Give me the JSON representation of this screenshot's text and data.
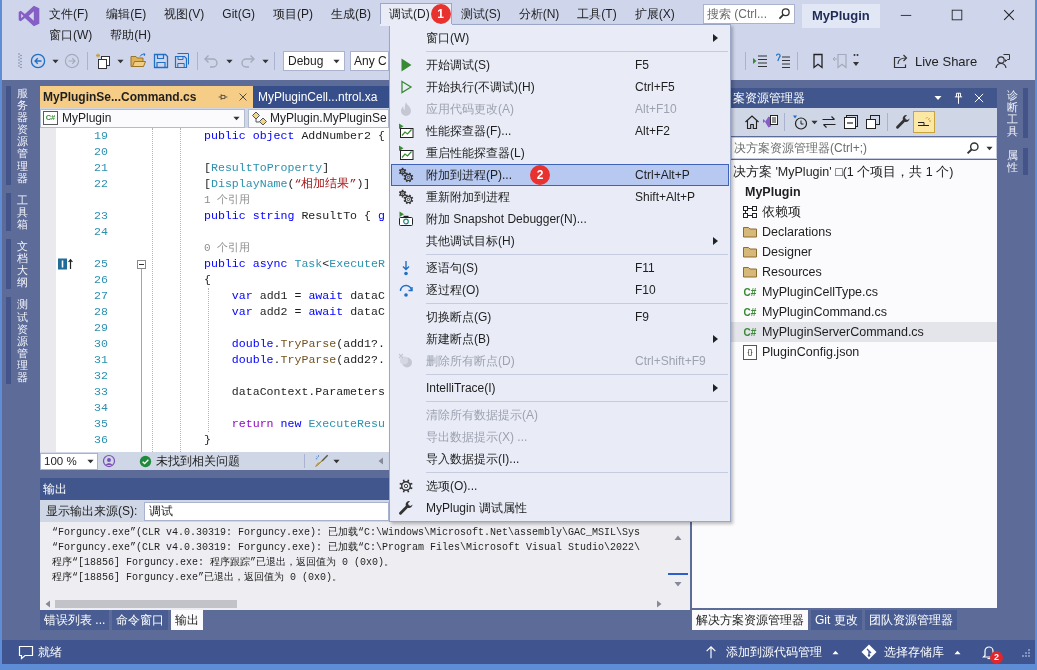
{
  "title_bar": {
    "menus": [
      {
        "label": "文件(F)",
        "selected": false
      },
      {
        "label": "编辑(E)",
        "selected": false
      },
      {
        "label": "视图(V)",
        "selected": false
      },
      {
        "label": "Git(G)",
        "selected": false
      },
      {
        "label": "项目(P)",
        "selected": false
      },
      {
        "label": "生成(B)",
        "selected": false
      },
      {
        "label": "调试(D)",
        "selected": true,
        "badge": "1"
      },
      {
        "label": "测试(S)",
        "selected": false
      },
      {
        "label": "分析(N)",
        "selected": false
      },
      {
        "label": "工具(T)",
        "selected": false
      },
      {
        "label": "扩展(X)",
        "selected": false
      },
      {
        "label": "窗口(W)",
        "selected": false
      },
      {
        "label": "帮助(H)",
        "selected": false
      }
    ],
    "search": {
      "placeholder": "搜索 (Ctrl..."
    },
    "title": "MyPlugin"
  },
  "toolbar": {
    "configuration": "Debug",
    "platform": "Any C",
    "live_share": "Live Share"
  },
  "left_tool_tabs": [
    "服务器资源管理器",
    "工具箱",
    "文档大纲",
    "测试资源管理器"
  ],
  "editor": {
    "tabs": [
      {
        "label": "MyPluginSe...Command.cs",
        "selected": true
      },
      {
        "label": "MyPluginCell...ntrol.xa",
        "selected": false
      }
    ],
    "project_selector": {
      "icon_text": "C#",
      "label": "MyPlugin"
    },
    "member_selector": "MyPlugin.MyPluginSe",
    "lines": [
      {
        "kind": "code",
        "number": "19",
        "tokens": [
          {
            "text": "public object ",
            "kind": "keyword"
          },
          {
            "text": "AddNumber2 {",
            "kind": "plain"
          }
        ]
      },
      {
        "kind": "code",
        "number": "20"
      },
      {
        "kind": "code",
        "number": "21",
        "tokens": [
          {
            "text": "[",
            "kind": "plain"
          },
          {
            "text": "ResultToProperty",
            "kind": "type"
          },
          {
            "text": "]",
            "kind": "plain"
          }
        ]
      },
      {
        "kind": "code",
        "number": "22",
        "tokens": [
          {
            "text": "[",
            "kind": "plain"
          },
          {
            "text": "DisplayName",
            "kind": "type"
          },
          {
            "text": "(",
            "kind": "plain"
          },
          {
            "text": "“相加结果”",
            "kind": "string"
          },
          {
            "text": ")]",
            "kind": "plain"
          }
        ]
      },
      {
        "kind": "codelens",
        "text": "1 个引用"
      },
      {
        "kind": "code",
        "number": "23",
        "tokens": [
          {
            "text": "public string ",
            "kind": "keyword"
          },
          {
            "text": "ResultTo { ",
            "kind": "plain"
          },
          {
            "text": "g",
            "kind": "keyword"
          }
        ]
      },
      {
        "kind": "code",
        "number": "24"
      },
      {
        "kind": "codelens",
        "text": "0 个引用"
      },
      {
        "kind": "code",
        "number": "25",
        "marker": true,
        "fold": {
          "expanded": true
        },
        "tokens": [
          {
            "text": "public async ",
            "kind": "keyword"
          },
          {
            "text": "Task",
            "kind": "type"
          },
          {
            "text": "<",
            "kind": "plain"
          },
          {
            "text": "ExecuteR",
            "kind": "type"
          }
        ]
      },
      {
        "kind": "code",
        "number": "26",
        "tokens": [
          {
            "text": "{",
            "kind": "plain"
          }
        ]
      },
      {
        "kind": "code",
        "number": "27",
        "tokens": [
          {
            "text": "    var ",
            "kind": "keyword"
          },
          {
            "text": "add1 = ",
            "kind": "plain"
          },
          {
            "text": "await ",
            "kind": "keyword"
          },
          {
            "text": "dataC",
            "kind": "plain"
          }
        ]
      },
      {
        "kind": "code",
        "number": "28",
        "tokens": [
          {
            "text": "    var ",
            "kind": "keyword"
          },
          {
            "text": "add2 = ",
            "kind": "plain"
          },
          {
            "text": "await ",
            "kind": "keyword"
          },
          {
            "text": "dataC",
            "kind": "plain"
          }
        ]
      },
      {
        "kind": "code",
        "number": "29"
      },
      {
        "kind": "code",
        "number": "30",
        "tokens": [
          {
            "text": "    double",
            "kind": "keyword"
          },
          {
            "text": ".",
            "kind": "plain"
          },
          {
            "text": "TryParse",
            "kind": "method"
          },
          {
            "text": "(add1?.",
            "kind": "plain"
          }
        ]
      },
      {
        "kind": "code",
        "number": "31",
        "tokens": [
          {
            "text": "    double",
            "kind": "keyword"
          },
          {
            "text": ".",
            "kind": "plain"
          },
          {
            "text": "TryParse",
            "kind": "method"
          },
          {
            "text": "(add2?.",
            "kind": "plain"
          }
        ]
      },
      {
        "kind": "code",
        "number": "32"
      },
      {
        "kind": "code",
        "number": "33",
        "tokens": [
          {
            "text": "    dataContext.Parameters",
            "kind": "plain"
          }
        ]
      },
      {
        "kind": "code",
        "number": "34"
      },
      {
        "kind": "code",
        "number": "35",
        "tokens": [
          {
            "text": "    return ",
            "kind": "control"
          },
          {
            "text": "new ",
            "kind": "keyword"
          },
          {
            "text": "ExecuteResu",
            "kind": "type"
          }
        ]
      },
      {
        "kind": "code",
        "number": "36",
        "tokens": [
          {
            "text": "}",
            "kind": "plain"
          }
        ]
      }
    ],
    "zoom": "100 %",
    "issues": "未找到相关问题"
  },
  "output": {
    "title": "输出",
    "source_label": "显示输出来源(S):",
    "source": "调试",
    "lines": [
      "“Forguncy.exe”(CLR v4.0.30319: Forguncy.exe): 已加载“C:\\Windows\\Microsoft.Net\\assembly\\GAC_MSIL\\Sys",
      "“Forguncy.exe”(CLR v4.0.30319: Forguncy.exe): 已加载“C:\\Program Files\\Microsoft Visual Studio\\2022\\",
      "程序“[18856] Forguncy.exe: 程序跟踪”已退出，返回值为 0 (0x0)。",
      "程序“[18856] Forguncy.exe”已退出，返回值为 0 (0x0)。"
    ],
    "tabs": [
      {
        "label": "错误列表 ...",
        "selected": false
      },
      {
        "label": "命令窗口",
        "selected": false
      },
      {
        "label": "输出",
        "selected": true
      }
    ]
  },
  "solution_explorer": {
    "title": "案资源管理器",
    "search": {
      "placeholder": "决方案资源管理器(Ctrl+;)"
    },
    "tree": [
      {
        "label": "决方案 'MyPlugin' □(1 个项目，共 1 个)",
        "selected": false,
        "children": [
          {
            "label": "MyPlugin",
            "kind": "project",
            "selected": false,
            "children": [
              {
                "label": "依赖项",
                "kind": "dependencies",
                "selected": false
              },
              {
                "label": "Declarations",
                "kind": "folder",
                "selected": false
              },
              {
                "label": "Designer",
                "kind": "folder",
                "selected": false
              },
              {
                "label": "Resources",
                "kind": "folder",
                "selected": false
              },
              {
                "label": "MyPluginCellType.cs",
                "kind": "code-file",
                "icon_text": "C#",
                "selected": false
              },
              {
                "label": "MyPluginCommand.cs",
                "kind": "code-file",
                "icon_text": "C#",
                "selected": false
              },
              {
                "label": "MyPluginServerCommand.cs",
                "kind": "code-file",
                "icon_text": "C#",
                "selected": true
              },
              {
                "label": "PluginConfig.json",
                "kind": "data-file",
                "icon_text": "{}",
                "selected": false
              }
            ]
          }
        ]
      }
    ],
    "tabs": [
      {
        "label": "解决方案资源管理器",
        "selected": true
      },
      {
        "label": "Git 更改",
        "selected": false
      },
      {
        "label": "团队资源管理器",
        "selected": false
      }
    ]
  },
  "right_tool_tabs": [
    "诊断工具",
    "属性"
  ],
  "status_bar": {
    "text": "就绪",
    "source_control": "添加到源代码管理",
    "repository": "选择存储库",
    "notification_count": "2"
  },
  "debug_menu": {
    "groups": [
      [
        {
          "label": "窗口(W)",
          "submenu": true,
          "disabled": false,
          "selected": false
        }
      ],
      [
        {
          "label": "开始调试(S)",
          "shortcut": "F5",
          "submenu": false,
          "disabled": false,
          "selected": false
        },
        {
          "label": "开始执行(不调试)(H)",
          "shortcut": "Ctrl+F5",
          "submenu": false,
          "disabled": false,
          "selected": false
        },
        {
          "label": "应用代码更改(A)",
          "shortcut": "Alt+F10",
          "submenu": false,
          "disabled": true,
          "selected": false
        },
        {
          "label": "性能探查器(F)...",
          "shortcut": "Alt+F2",
          "submenu": false,
          "disabled": false,
          "selected": false
        },
        {
          "label": "重启性能探查器(L)",
          "submenu": false,
          "disabled": false,
          "selected": false
        },
        {
          "label": "附加到进程(P)...",
          "shortcut": "Ctrl+Alt+P",
          "submenu": false,
          "disabled": false,
          "selected": true,
          "badge": "2"
        },
        {
          "label": "重新附加到进程",
          "shortcut": "Shift+Alt+P",
          "submenu": false,
          "disabled": false,
          "selected": false
        },
        {
          "label": "附加 Snapshot Debugger(N)...",
          "submenu": false,
          "disabled": false,
          "selected": false
        },
        {
          "label": "其他调试目标(H)",
          "submenu": true,
          "disabled": false,
          "selected": false
        }
      ],
      [
        {
          "label": "逐语句(S)",
          "shortcut": "F11",
          "submenu": false,
          "disabled": false,
          "selected": false
        },
        {
          "label": "逐过程(O)",
          "shortcut": "F10",
          "submenu": false,
          "disabled": false,
          "selected": false
        }
      ],
      [
        {
          "label": "切换断点(G)",
          "shortcut": "F9",
          "submenu": false,
          "disabled": false,
          "selected": false
        },
        {
          "label": "新建断点(B)",
          "submenu": true,
          "disabled": false,
          "selected": false
        },
        {
          "label": "删除所有断点(D)",
          "shortcut": "Ctrl+Shift+F9",
          "submenu": false,
          "disabled": true,
          "selected": false
        }
      ],
      [
        {
          "label": "IntelliTrace(I)",
          "submenu": true,
          "disabled": false,
          "selected": false
        }
      ],
      [
        {
          "label": "清除所有数据提示(A)",
          "submenu": false,
          "disabled": true,
          "selected": false
        },
        {
          "label": "导出数据提示(X) ...",
          "submenu": false,
          "disabled": true,
          "selected": false
        },
        {
          "label": "导入数据提示(I)...",
          "submenu": false,
          "disabled": false,
          "selected": false
        }
      ],
      [
        {
          "label": "选项(O)...",
          "submenu": false,
          "disabled": false,
          "selected": false
        },
        {
          "label": "MyPlugin 调试属性",
          "submenu": false,
          "disabled": false,
          "selected": false
        }
      ]
    ]
  }
}
